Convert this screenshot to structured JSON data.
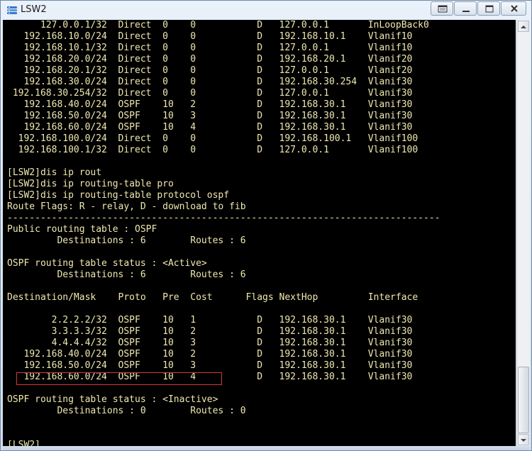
{
  "window": {
    "title": "LSW2"
  },
  "icons": {
    "app": "switch-app-icon",
    "restore": "restore-icon",
    "minimize": "minimize-icon",
    "maximize": "maximize-icon",
    "close": "close-icon",
    "scroll_up": "arrow-up-icon",
    "scroll_down": "arrow-down-icon"
  },
  "colors": {
    "terminal_bg": "#000000",
    "terminal_text": "#f0e8b0",
    "highlight_border": "#d23b3b"
  },
  "terminal": {
    "lines": [
      "      127.0.0.1/32  Direct  0    0           D   127.0.0.1       InLoopBack0",
      "   192.168.10.0/24  Direct  0    0           D   192.168.10.1    Vlanif10",
      "   192.168.10.1/32  Direct  0    0           D   127.0.0.1       Vlanif10",
      "   192.168.20.0/24  Direct  0    0           D   192.168.20.1    Vlanif20",
      "   192.168.20.1/32  Direct  0    0           D   127.0.0.1       Vlanif20",
      "   192.168.30.0/24  Direct  0    0           D   192.168.30.254  Vlanif30",
      " 192.168.30.254/32  Direct  0    0           D   127.0.0.1       Vlanif30",
      "   192.168.40.0/24  OSPF    10   2           D   192.168.30.1    Vlanif30",
      "   192.168.50.0/24  OSPF    10   3           D   192.168.30.1    Vlanif30",
      "   192.168.60.0/24  OSPF    10   4           D   192.168.30.1    Vlanif30",
      "  192.168.100.0/24  Direct  0    0           D   192.168.100.1   Vlanif100",
      "  192.168.100.1/32  Direct  0    0           D   127.0.0.1       Vlanif100",
      "",
      "[LSW2]dis ip rout",
      "[LSW2]dis ip routing-table pro",
      "[LSW2]dis ip routing-table protocol ospf",
      "Route Flags: R - relay, D - download to fib",
      "------------------------------------------------------------------------------",
      "Public routing table : OSPF",
      "         Destinations : 6        Routes : 6",
      "",
      "OSPF routing table status : <Active>",
      "         Destinations : 6        Routes : 6",
      "",
      "Destination/Mask    Proto   Pre  Cost      Flags NextHop         Interface",
      "",
      "        2.2.2.2/32  OSPF    10   1           D   192.168.30.1    Vlanif30",
      "        3.3.3.3/32  OSPF    10   2           D   192.168.30.1    Vlanif30",
      "        4.4.4.4/32  OSPF    10   3           D   192.168.30.1    Vlanif30",
      "   192.168.40.0/24  OSPF    10   2           D   192.168.30.1    Vlanif30",
      "   192.168.50.0/24  OSPF    10   3           D   192.168.30.1    Vlanif30",
      "   192.168.60.0/24  OSPF    10   4           D   192.168.30.1    Vlanif30",
      "",
      "OSPF routing table status : <Inactive>",
      "         Destinations : 0        Routes : 0",
      "",
      "",
      "[LSW2]"
    ]
  }
}
